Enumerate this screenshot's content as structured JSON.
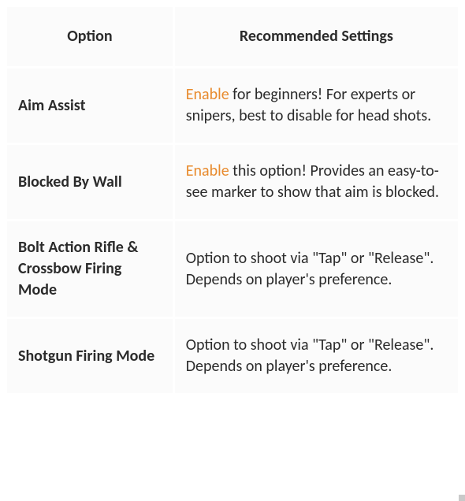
{
  "headers": {
    "option": "Option",
    "recommended": "Recommended Settings"
  },
  "highlight_color": "#e88b2e",
  "rows": [
    {
      "option": "Aim Assist",
      "highlight": "Enable",
      "rest": " for beginners! For experts or snipers, best to disable for head shots."
    },
    {
      "option": "Blocked By Wall",
      "highlight": "Enable",
      "rest": " this option! Provides an easy-to-see marker to show that aim is blocked."
    },
    {
      "option": "Bolt Action Rifle & Crossbow Firing Mode",
      "highlight": "",
      "rest": "Option to shoot via \"Tap\" or \"Release\". Depends on player's preference."
    },
    {
      "option": "Shotgun Firing Mode",
      "highlight": "",
      "rest": "Option to shoot via \"Tap\" or \"Release\". Depends on player's preference."
    }
  ]
}
